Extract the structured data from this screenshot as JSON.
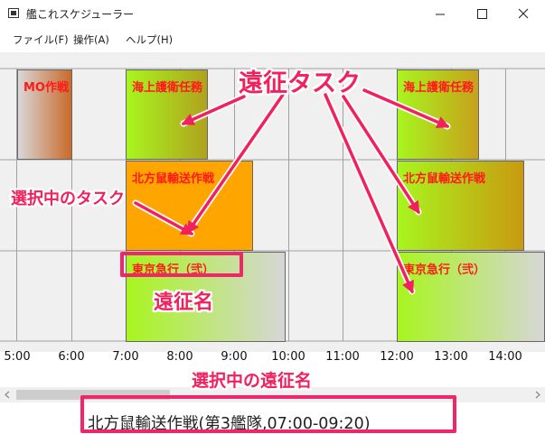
{
  "window": {
    "title": "艦これスケジューラー"
  },
  "menu": [
    "ファイル(F)",
    "操作(A)",
    "ヘルプ(H)"
  ],
  "time_axis": [
    "5:00",
    "6:00",
    "7:00",
    "8:00",
    "9:00",
    "10:00",
    "11:00",
    "12:00",
    "13:00",
    "14:00"
  ],
  "tasks": [
    {
      "label": "MO作戦",
      "start": "5:00",
      "end": "6:00",
      "fleet": 1,
      "selected": false
    },
    {
      "label": "海上護衛任務",
      "start": "7:00",
      "end": "8:30",
      "fleet": 1,
      "selected": false
    },
    {
      "label": "海上護衛任務",
      "start": "12:00",
      "end": "13:30",
      "fleet": 1,
      "selected": false
    },
    {
      "label": "北方鼠輸送作戦",
      "start": "7:00",
      "end": "9:20",
      "fleet": 2,
      "selected": true
    },
    {
      "label": "北方鼠輸送作戦",
      "start": "12:00",
      "end": "14:20",
      "fleet": 2,
      "selected": false
    },
    {
      "label": "東京急行（弐）",
      "start": "7:00",
      "end": "10:00",
      "fleet": 3,
      "selected": false
    },
    {
      "label": "東京急行（弐）",
      "start": "12:00",
      "end": "15:00",
      "fleet": 3,
      "selected": false
    }
  ],
  "status_text": "北方鼠輸送作戦(第3艦隊,07:00-09:20)",
  "annotations": {
    "expedition_task": "遠征タスク",
    "selected_task": "選択中のタスク",
    "expedition_name": "遠征名",
    "selected_expedition_name": "選択中の遠征名"
  },
  "colors": {
    "annotation": "#f2205c",
    "label_red": "#ff1a1a",
    "selected_fill": "#ffa500",
    "green": "#a8f51f"
  }
}
